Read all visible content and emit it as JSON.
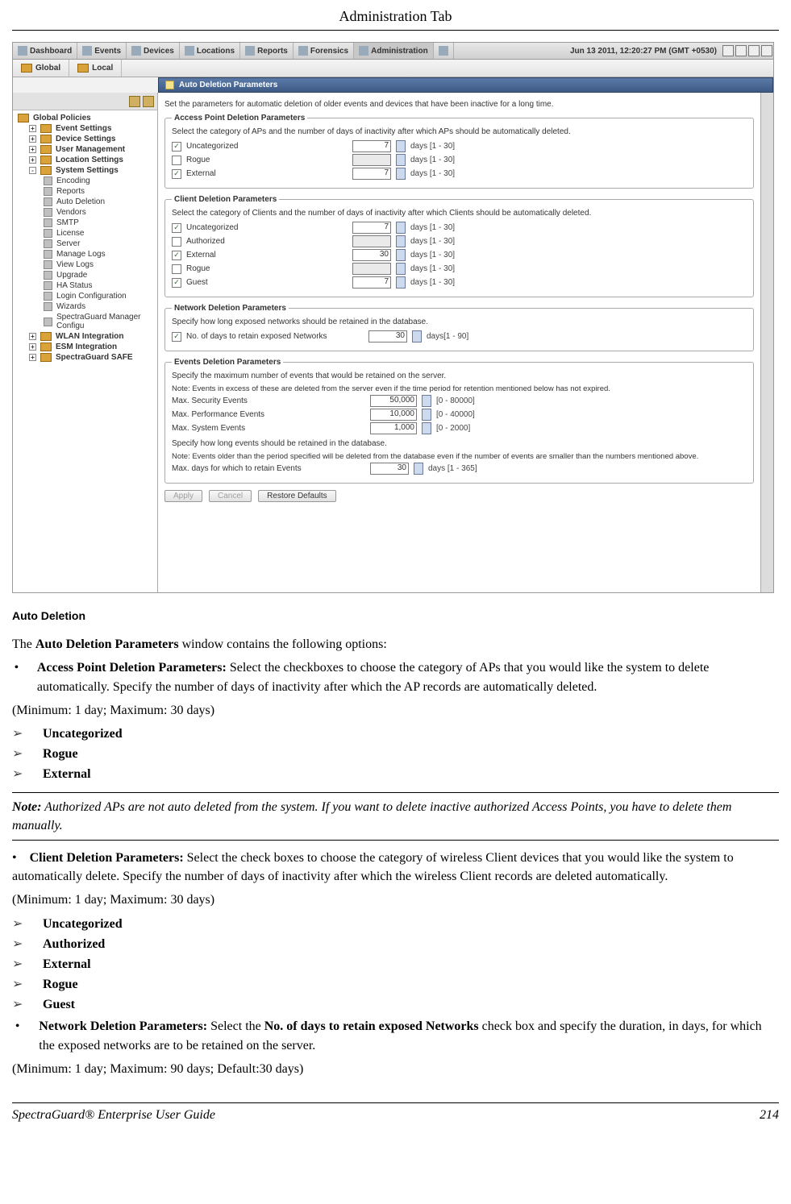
{
  "header": {
    "title": "Administration Tab"
  },
  "screenshot": {
    "topbar": {
      "tabs": [
        "Dashboard",
        "Events",
        "Devices",
        "Locations",
        "Reports",
        "Forensics",
        "Administration"
      ],
      "time": "Jun 13 2011, 12:20:27 PM (GMT +0530)"
    },
    "subbar": {
      "tabs": [
        "Global",
        "Local"
      ]
    },
    "panel_title": "Auto Deletion Parameters",
    "sidebar": {
      "root": "Global Policies",
      "groups": [
        {
          "label": "Event Settings",
          "expand": "+"
        },
        {
          "label": "Device Settings",
          "expand": "+"
        },
        {
          "label": "User Management",
          "expand": "+"
        },
        {
          "label": "Location Settings",
          "expand": "+"
        }
      ],
      "system": {
        "label": "System Settings",
        "expand": "-",
        "items": [
          "Encoding",
          "Reports",
          "Auto Deletion",
          "Vendors",
          "SMTP",
          "License",
          "Server",
          "Manage Logs",
          "View Logs",
          "Upgrade",
          "HA Status",
          "Login Configuration",
          "Wizards",
          "SpectraGuard Manager Configu"
        ]
      },
      "footer_groups": [
        {
          "label": "WLAN Integration",
          "expand": "+"
        },
        {
          "label": "ESM Integration",
          "expand": "+"
        },
        {
          "label": "SpectraGuard SAFE",
          "expand": "+"
        }
      ]
    },
    "main": {
      "intro": "Set the parameters for automatic deletion of older events and devices that have been inactive for a long time.",
      "ap": {
        "legend": "Access Point Deletion Parameters",
        "desc": "Select the category of APs and the number of days of inactivity after which APs should be automatically deleted.",
        "rows": [
          {
            "label": "Uncategorized",
            "checked": true,
            "value": "7",
            "hint": "days [1 - 30]"
          },
          {
            "label": "Rogue",
            "checked": false,
            "value": "",
            "hint": "days [1 - 30]"
          },
          {
            "label": "External",
            "checked": true,
            "value": "7",
            "hint": "days [1 - 30]"
          }
        ]
      },
      "client": {
        "legend": "Client Deletion Parameters",
        "desc": "Select the category of Clients and the number of days of inactivity after which Clients should be automatically deleted.",
        "rows": [
          {
            "label": "Uncategorized",
            "checked": true,
            "value": "7",
            "hint": "days [1 - 30]"
          },
          {
            "label": "Authorized",
            "checked": false,
            "value": "",
            "hint": "days [1 - 30]"
          },
          {
            "label": "External",
            "checked": true,
            "value": "30",
            "hint": "days [1 - 30]"
          },
          {
            "label": "Rogue",
            "checked": false,
            "value": "",
            "hint": "days [1 - 30]"
          },
          {
            "label": "Guest",
            "checked": true,
            "value": "7",
            "hint": "days [1 - 30]"
          }
        ]
      },
      "network": {
        "legend": "Network Deletion Parameters",
        "desc": "Specify how long exposed networks should be retained in the database.",
        "row": {
          "label": "No. of days to retain exposed Networks",
          "checked": true,
          "value": "30",
          "hint": "days[1 - 90]"
        }
      },
      "events": {
        "legend": "Events Deletion Parameters",
        "desc1": "Specify the maximum number of events that would be retained on the server.",
        "note1": "Note: Events in excess of these are deleted from the server even if the time period for retention mentioned below has not expired.",
        "rows": [
          {
            "label": "Max. Security Events",
            "value": "50,000",
            "hint": "[0 - 80000]"
          },
          {
            "label": "Max. Performance Events",
            "value": "10,000",
            "hint": "[0 - 40000]"
          },
          {
            "label": "Max. System Events",
            "value": "1,000",
            "hint": "[0 - 2000]"
          }
        ],
        "desc2": "Specify how long events should be retained in the database.",
        "note2": "Note: Events older than the period specified will be deleted from the database even if the number of events are smaller than the numbers mentioned above.",
        "retain": {
          "label": "Max. days for which to retain Events",
          "value": "30",
          "hint": "days [1 - 365]"
        }
      },
      "buttons": {
        "apply": "Apply",
        "cancel": "Cancel",
        "restore": "Restore Defaults"
      }
    }
  },
  "doc": {
    "heading": "Auto Deletion",
    "intro_pre": "The ",
    "intro_bold": "Auto Deletion Parameters",
    "intro_post": " window contains the following options:",
    "ap_bold": "Access Point Deletion Parameters: ",
    "ap_text": "Select the checkboxes to choose the category of APs that you would like the system to delete automatically. Specify the number of days of inactivity after which the AP records are automatically deleted.",
    "ap_range": "(Minimum: 1 day; Maximum: 30 days)",
    "ap_items": [
      "Uncategorized",
      "Rogue",
      "External"
    ],
    "note_label": "Note:",
    "note_text": " Authorized APs are not auto deleted from the system. If you want to delete inactive authorized Access Points, you have to delete them manually.",
    "cl_lead": "• ",
    "cl_bold": "Client Deletion Parameters: ",
    "cl_text": "Select the check boxes to choose the category of wireless Client devices that you would like the system to automatically delete. Specify the number of days of inactivity after which the wireless Client records are deleted automatically.",
    "cl_range": "(Minimum: 1 day; Maximum: 30 days)",
    "cl_items": [
      "Uncategorized",
      "Authorized",
      "External",
      "Rogue",
      "Guest"
    ],
    "net_bold": "Network Deletion Parameters: ",
    "net_text_pre": "Select the ",
    "net_text_bold": "No. of days to retain exposed Networks",
    "net_text_post": " check box and specify the duration, in days, for which the exposed networks are to be retained on the server.",
    "net_range": "(Minimum: 1 day; Maximum: 90 days; Default:30 days)"
  },
  "footer": {
    "left": "SpectraGuard®  Enterprise User Guide",
    "right": "214"
  }
}
